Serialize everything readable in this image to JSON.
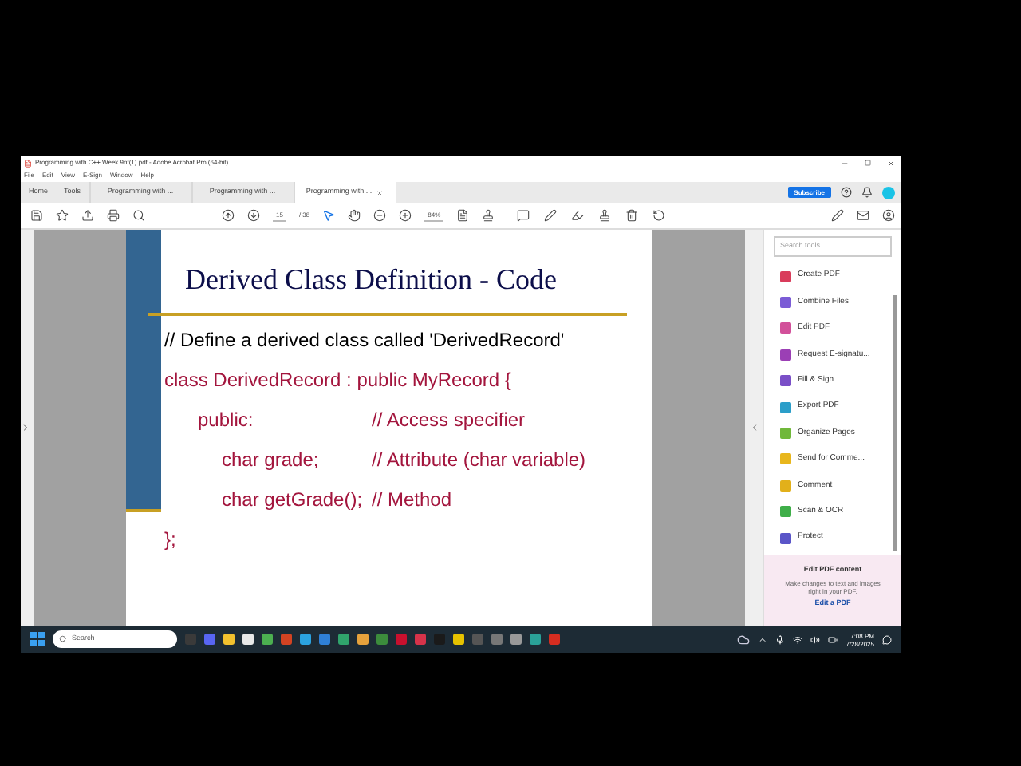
{
  "window": {
    "title": "Programming with C++ Week 9nt(1).pdf - Adobe Acrobat Pro (64-bit)"
  },
  "menu": [
    "File",
    "Edit",
    "View",
    "E-Sign",
    "Window",
    "Help"
  ],
  "tabs": [
    {
      "label": "Home",
      "selected": false,
      "closable": false
    },
    {
      "label": "Tools",
      "selected": false,
      "closable": false
    },
    {
      "label": "Programming with ...",
      "selected": false,
      "closable": false
    },
    {
      "label": "Programming with ...",
      "selected": false,
      "closable": false
    },
    {
      "label": "Programming with ...",
      "selected": true,
      "closable": true
    }
  ],
  "subscribe_button": "Subscribe",
  "toolbar": {
    "page": "15",
    "pages": "/ 38",
    "zoom": "84%"
  },
  "slide": {
    "title": "Derived Class Definition - Code",
    "lines": [
      {
        "kind": "comment",
        "text": "// Define a derived class called 'DerivedRecord'"
      },
      {
        "kind": "code",
        "text": "class DerivedRecord : public MyRecord {",
        "children": [
          {
            "kind": "code",
            "text": "public:",
            "comment": "// Access specifier",
            "children": [
              {
                "kind": "code",
                "text": "char grade;",
                "comment": "// Attribute (char variable)"
              },
              {
                "kind": "code",
                "text": "char getGrade();",
                "comment": "// Method"
              }
            ]
          }
        ]
      },
      {
        "kind": "code",
        "text": "};"
      }
    ]
  },
  "tools_panel": {
    "search": {
      "placeholder": "Search tools"
    },
    "tools": [
      {
        "label": "Create PDF",
        "color": "#d93c5b"
      },
      {
        "label": "Combine Files",
        "color": "#7b5cd6"
      },
      {
        "label": "Edit PDF",
        "color": "#d2509a"
      },
      {
        "label": "Request E-signatu...",
        "color": "#9b3fb5"
      },
      {
        "label": "Fill & Sign",
        "color": "#7a4fc7"
      },
      {
        "label": "Export PDF",
        "color": "#2b9ec9"
      },
      {
        "label": "Organize Pages",
        "color": "#70b83a"
      },
      {
        "label": "Send for Comme...",
        "color": "#e8b61c"
      },
      {
        "label": "Comment",
        "color": "#e2b01a"
      },
      {
        "label": "Scan & OCR",
        "color": "#3fae49"
      },
      {
        "label": "Protect",
        "color": "#5a55c8"
      }
    ],
    "promo": {
      "title": "Edit PDF content",
      "text": "Make changes to text and images right in your PDF.",
      "link": "Edit a PDF"
    }
  },
  "taskbar": {
    "search": {
      "placeholder": "Search"
    },
    "time": "7:08 PM",
    "date": "7/28/2025"
  }
}
